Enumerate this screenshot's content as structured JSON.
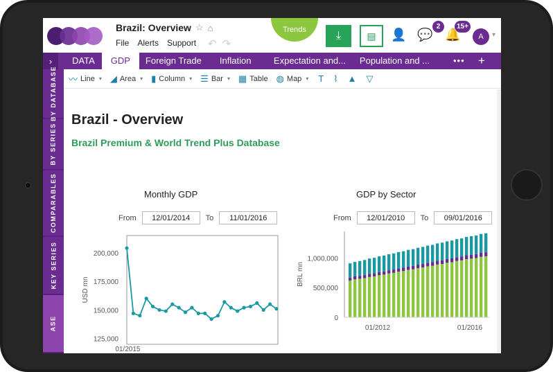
{
  "header": {
    "doc_title": "Brazil: Overview",
    "menu": [
      "File",
      "Alerts",
      "Support"
    ],
    "trends_label": "Trends",
    "messages_count": "2",
    "alerts_count": "15+",
    "avatar_initial": "A"
  },
  "tabs": [
    "DATA",
    "GDP",
    "Foreign Trade",
    "Inflation",
    "Expectation and...",
    "Population and ..."
  ],
  "tab_more": "•••",
  "tab_add": "+",
  "toolbar": {
    "line": "Line",
    "area": "Area",
    "column": "Column",
    "bar": "Bar",
    "table": "Table",
    "map": "Map"
  },
  "sidebar": [
    "BY DATABASE",
    "BY SERIES",
    "COMPARABLES",
    "KEY SERIES",
    "ASE"
  ],
  "page": {
    "title": "Brazil - Overview",
    "subtitle": "Brazil Premium & World Trend Plus Database"
  },
  "chart_left": {
    "title": "Monthly GDP",
    "from_label": "From",
    "from_value": "12/01/2014",
    "to_label": "To",
    "to_value": "11/01/2016"
  },
  "chart_right": {
    "title": "GDP by Sector",
    "from_label": "From",
    "from_value": "12/01/2010",
    "to_label": "To",
    "to_value": "09/01/2016"
  },
  "colors": {
    "brand_purple": "#6a2c91",
    "green": "#27a35a",
    "line_teal": "#1a9aa0",
    "bar_green": "#8dc63f",
    "bar_purple": "#6a2c91",
    "bar_teal": "#1a9aa0"
  },
  "chart_data": [
    {
      "type": "line",
      "title": "Monthly GDP",
      "ylabel": "USD mn",
      "ylim": [
        120000,
        215000
      ],
      "yticks": [
        "200,000",
        "175,000",
        "150,000",
        "125,000"
      ],
      "xticks": [
        "01/2015"
      ],
      "series": [
        {
          "values": [
            204000,
            147000,
            145000,
            160000,
            153000,
            150000,
            149000,
            155000,
            152000,
            148000,
            152000,
            147000,
            147000,
            142000,
            145000,
            157000,
            152000,
            149000,
            152000,
            153000,
            156000,
            150000,
            155000,
            151000
          ]
        }
      ],
      "grid": false
    },
    {
      "type": "bar",
      "stacked": true,
      "title": "GDP by Sector",
      "ylabel": "BRL mn",
      "ylim": [
        0,
        1450000
      ],
      "yticks": [
        "1,000,000",
        "500,000",
        "0"
      ],
      "xticks": [
        "01/2012",
        "01/2016"
      ],
      "series": [
        {
          "color": "#8dc63f",
          "values": [
            620000,
            640000,
            650000,
            660000,
            680000,
            690000,
            710000,
            720000,
            740000,
            750000,
            770000,
            780000,
            800000,
            810000,
            830000,
            840000,
            860000,
            870000,
            890000,
            900000,
            920000,
            930000,
            950000,
            960000,
            980000,
            990000,
            1000000,
            1020000,
            1030000
          ]
        },
        {
          "color": "#6a2c91",
          "values": [
            50000,
            50000,
            50000,
            52000,
            52000,
            52000,
            54000,
            54000,
            54000,
            56000,
            56000,
            56000,
            58000,
            58000,
            58000,
            60000,
            60000,
            60000,
            62000,
            62000,
            62000,
            64000,
            64000,
            64000,
            66000,
            66000,
            66000,
            68000,
            68000
          ]
        },
        {
          "color": "#1a9aa0",
          "values": [
            240000,
            245000,
            250000,
            255000,
            260000,
            262000,
            265000,
            268000,
            270000,
            272000,
            275000,
            278000,
            280000,
            282000,
            285000,
            288000,
            290000,
            292000,
            295000,
            298000,
            300000,
            302000,
            305000,
            308000,
            310000,
            312000,
            315000,
            318000,
            320000
          ]
        }
      ],
      "grid": false
    }
  ]
}
